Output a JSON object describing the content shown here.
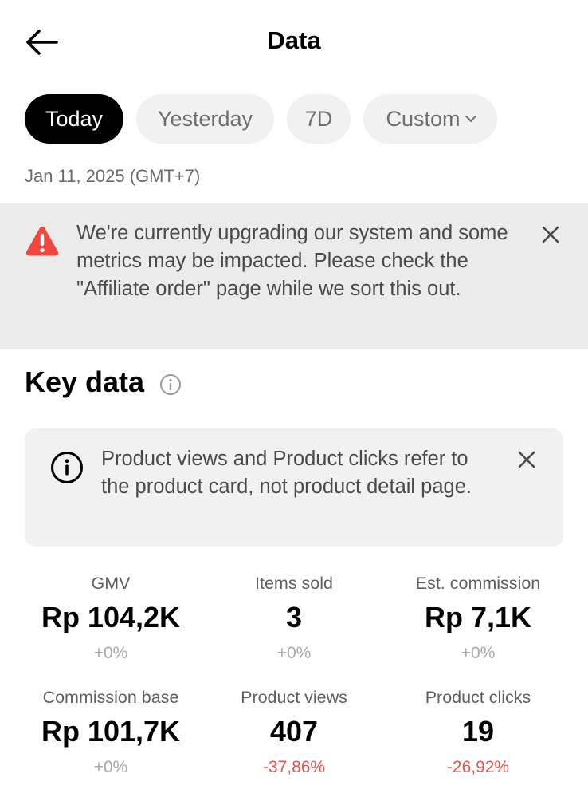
{
  "header": {
    "title": "Data",
    "back_icon": "arrow-left-icon"
  },
  "date_range": {
    "tabs": [
      {
        "label": "Today",
        "active": true
      },
      {
        "label": "Yesterday",
        "active": false
      },
      {
        "label": "7D",
        "active": false
      },
      {
        "label": "Custom",
        "active": false,
        "icon": "chevron-down-icon"
      }
    ],
    "date_text": "Jan 11, 2025 (GMT+7)"
  },
  "warning": {
    "icon": "warning-triangle-icon",
    "icon_color": "#f0473f",
    "text": "We're currently upgrading our system and some metrics may be impacted. Please check the \"Affiliate order\" page while we sort this out.",
    "close_icon": "close-icon"
  },
  "key_data": {
    "title": "Key data",
    "info_icon": "info-icon",
    "notice": {
      "icon": "info-circle-icon",
      "text": "Product views and Product clicks refer to the product card, not product detail page.",
      "close_icon": "close-icon"
    },
    "metrics": [
      {
        "label": "GMV",
        "value": "Rp 104,2K",
        "change": "+0%",
        "trend": "neutral"
      },
      {
        "label": "Items sold",
        "value": "3",
        "change": "+0%",
        "trend": "neutral"
      },
      {
        "label": "Est. commission",
        "value": "Rp 7,1K",
        "change": "+0%",
        "trend": "neutral"
      },
      {
        "label": "Commission base",
        "value": "Rp 101,7K",
        "change": "+0%",
        "trend": "neutral"
      },
      {
        "label": "Product views",
        "value": "407",
        "change": "-37,86%",
        "trend": "negative"
      },
      {
        "label": "Product clicks",
        "value": "19",
        "change": "-26,92%",
        "trend": "negative"
      }
    ]
  },
  "colors": {
    "active_tab_bg": "#000000",
    "inactive_tab_bg": "#f1f1f1",
    "banner_bg": "#ebebeb",
    "negative_change": "#e5574b",
    "neutral_change": "#a8a8a8"
  }
}
